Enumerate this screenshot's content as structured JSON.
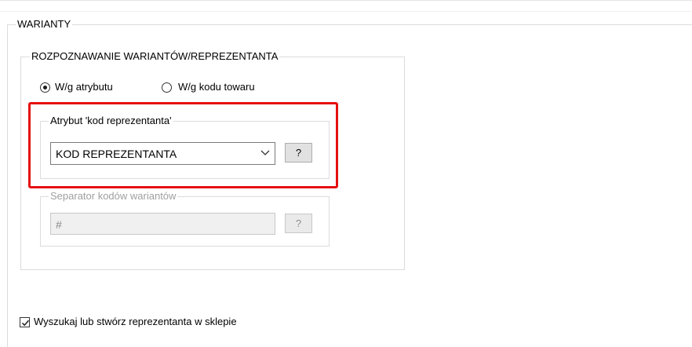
{
  "warianty": {
    "title": "WARIANTY"
  },
  "rozpoznawanie": {
    "title": "ROZPOZNAWANIE WARIANTÓW/REPREZENTANTA",
    "radio_attr_label": "W/g atrybutu",
    "radio_code_label": "W/g kodu towaru",
    "selected": "W/g atrybutu"
  },
  "atrybut": {
    "title": "Atrybut 'kod reprezentanta'",
    "value": "KOD REPREZENTANTA",
    "help_label": "?"
  },
  "separator": {
    "title": "Separator kodów wariantów",
    "value": "#",
    "help_label": "?"
  },
  "checkbox": {
    "label": "Wyszukaj lub stwórz reprezentanta w sklepie",
    "checked": true
  },
  "colors": {
    "highlight": "#e41010"
  }
}
